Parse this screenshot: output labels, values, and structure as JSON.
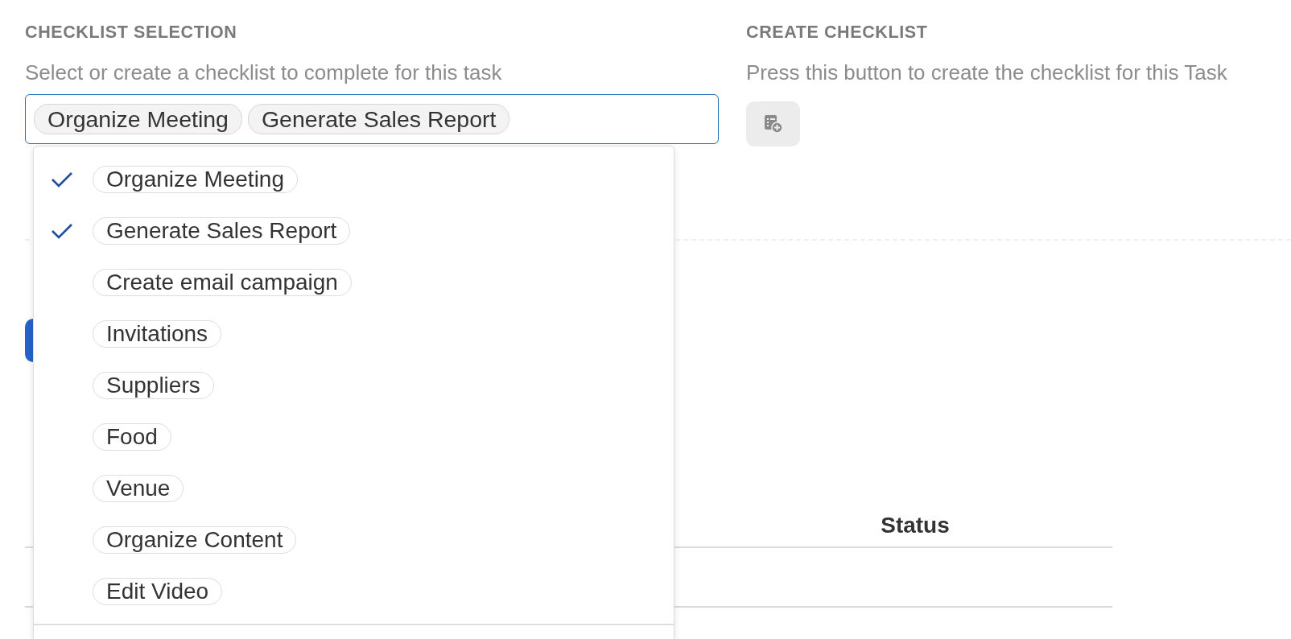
{
  "checklist_selection": {
    "title": "CHECKLIST SELECTION",
    "description": "Select or create a checklist to complete for this task",
    "selected_tags": [
      "Organize Meeting",
      "Generate Sales Report"
    ],
    "dropdown_options": [
      {
        "label": "Organize Meeting",
        "checked": true
      },
      {
        "label": "Generate Sales Report",
        "checked": true
      },
      {
        "label": "Create email campaign",
        "checked": false
      },
      {
        "label": "Invitations",
        "checked": false
      },
      {
        "label": "Suppliers",
        "checked": false
      },
      {
        "label": "Food",
        "checked": false
      },
      {
        "label": "Venue",
        "checked": false
      },
      {
        "label": "Organize Content",
        "checked": false
      },
      {
        "label": "Edit Video",
        "checked": false
      }
    ]
  },
  "create_checklist": {
    "title": "CREATE CHECKLIST",
    "description": "Press this button to create the checklist for this Task"
  },
  "covered_content": [
    {
      "kind": "divider"
    },
    {
      "kind": "button"
    },
    {
      "kind": "table",
      "columns": [
        "Status"
      ]
    }
  ]
}
